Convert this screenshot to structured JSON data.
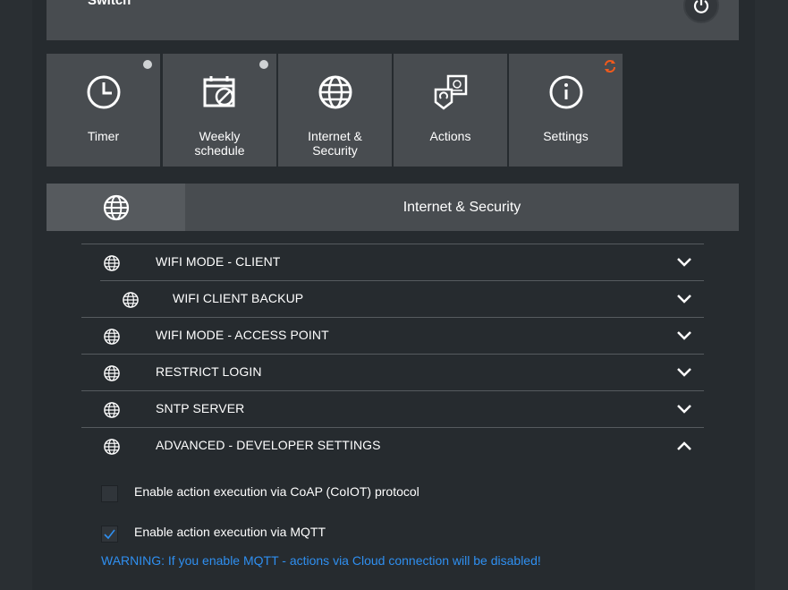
{
  "switch": {
    "label": "Switch",
    "power_icon": "power-icon"
  },
  "tiles": [
    {
      "label": "Timer",
      "icon": "clock-icon",
      "indicator": "dot"
    },
    {
      "label": "Weekly schedule",
      "icon": "calendar-disabled-icon",
      "indicator": "dot"
    },
    {
      "label": "Internet & Security",
      "icon": "globe-icon",
      "indicator": "none"
    },
    {
      "label": "Actions",
      "icon": "actions-icon",
      "indicator": "none"
    },
    {
      "label": "Settings",
      "icon": "info-icon",
      "indicator": "sync"
    }
  ],
  "section": {
    "title": "Internet & Security",
    "icon": "globe-icon"
  },
  "rows": [
    {
      "label": "WIFI MODE - CLIENT",
      "expanded": false
    },
    {
      "label": "WIFI CLIENT BACKUP",
      "expanded": false,
      "sub": true
    },
    {
      "label": "WIFI MODE - ACCESS POINT",
      "expanded": false
    },
    {
      "label": "RESTRICT LOGIN",
      "expanded": false
    },
    {
      "label": "SNTP SERVER",
      "expanded": false
    },
    {
      "label": "ADVANCED - DEVELOPER SETTINGS",
      "expanded": true
    }
  ],
  "options": [
    {
      "label": "Enable action execution via CoAP (CoIOT) protocol",
      "checked": false
    },
    {
      "label": "Enable action execution via MQTT",
      "checked": true
    }
  ],
  "warning": "WARNING: If you enable MQTT - actions via Cloud connection will be disabled!",
  "colors": {
    "accent_blue": "#2f8ff0",
    "sync_orange": "#f25a1c",
    "panel": "#484c50"
  }
}
